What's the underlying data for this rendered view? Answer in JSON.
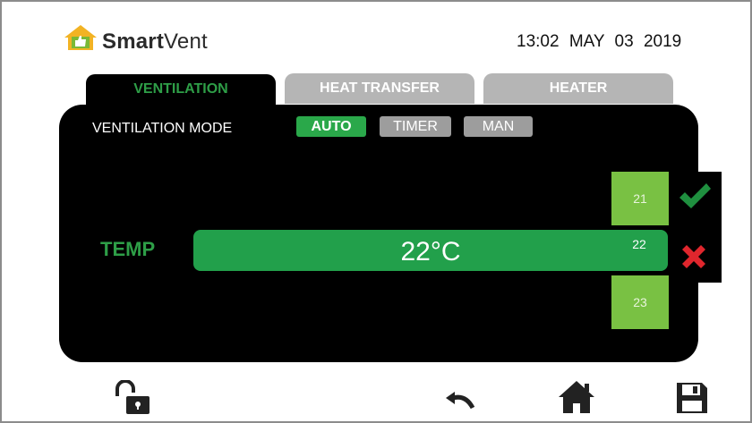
{
  "header": {
    "brand_bold": "Smart",
    "brand_light": "Vent",
    "time": "13:02",
    "date": "MAY 03 2019"
  },
  "tabs": [
    {
      "label": "VENTILATION",
      "active": true
    },
    {
      "label": "HEAT TRANSFER",
      "active": false
    },
    {
      "label": "HEATER",
      "active": false
    }
  ],
  "ventilation": {
    "mode_label": "VENTILATION MODE",
    "modes": [
      {
        "label": "AUTO",
        "selected": true
      },
      {
        "label": "TIMER",
        "selected": false
      },
      {
        "label": "MAN",
        "selected": false
      }
    ],
    "temp_label": "TEMP",
    "temp_value": "22°C",
    "picker": [
      "21",
      "22",
      "23"
    ]
  },
  "icons": {
    "logo": "house-thumbs-up-icon",
    "confirm": "check-icon",
    "cancel": "close-icon",
    "lock": "unlock-icon",
    "back": "undo-icon",
    "home": "home-icon",
    "save": "save-icon"
  },
  "colors": {
    "accent_green": "#2aa84a",
    "picker_green": "#79c143",
    "cancel_red": "#e0262d",
    "inactive_gray": "#b5b5b5"
  }
}
